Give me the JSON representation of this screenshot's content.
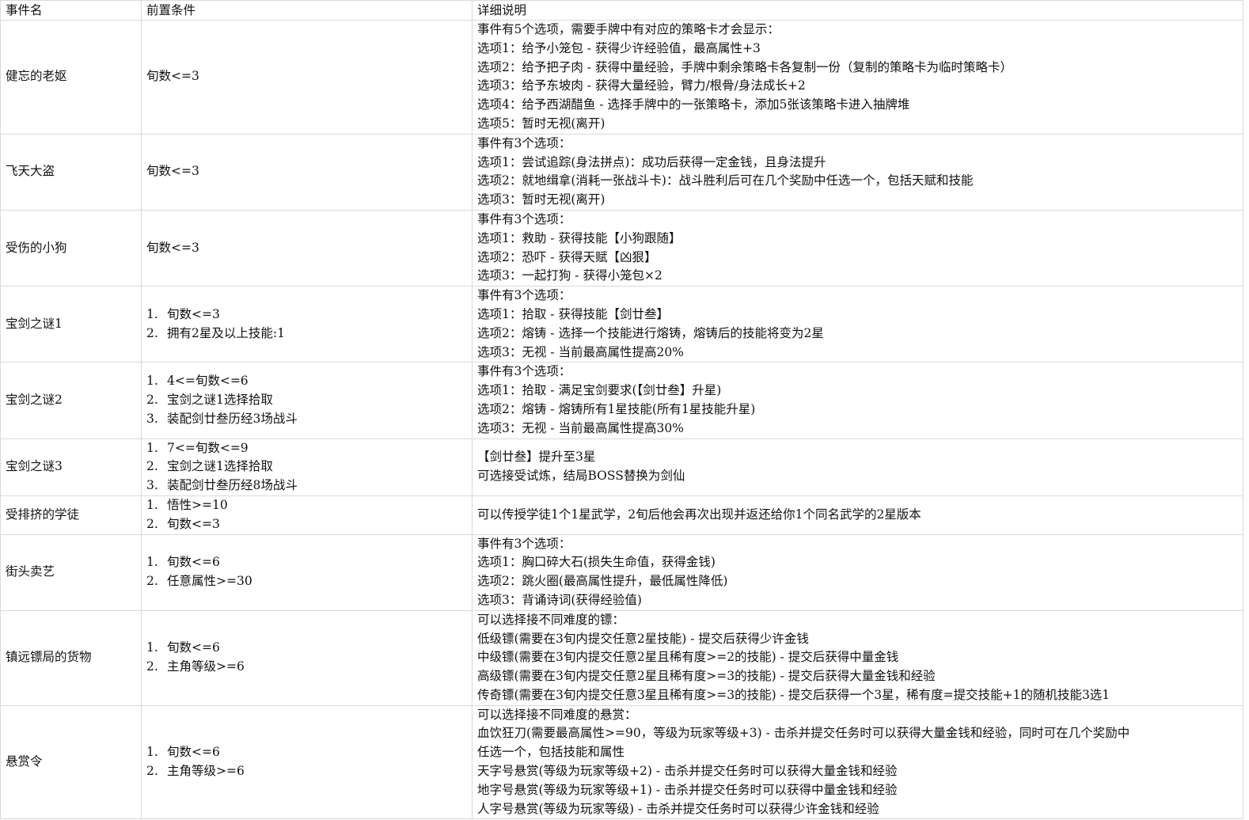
{
  "headers": {
    "event_name": "事件名",
    "precondition": "前置条件",
    "details": "详细说明"
  },
  "rows": [
    {
      "name": "健忘的老妪",
      "pre": [
        "旬数<=3"
      ],
      "details": [
        "事件有5个选项，需要手牌中有对应的策略卡才会显示：",
        "选项1：给予小笼包 - 获得少许经验值，最高属性+3",
        "选项2：给予把子肉 - 获得中量经验，手牌中剩余策略卡各复制一份（复制的策略卡为临时策略卡）",
        "选项3：给予东坡肉 - 获得大量经验，臂力/根骨/身法成长+2",
        "选项4：给予西湖醋鱼 - 选择手牌中的一张策略卡，添加5张该策略卡进入抽牌堆",
        "选项5：暂时无视(离开)"
      ]
    },
    {
      "name": "飞天大盗",
      "pre": [
        "旬数<=3"
      ],
      "details": [
        "事件有3个选项：",
        "选项1：尝试追踪(身法拼点)：成功后获得一定金钱，且身法提升",
        "选项2：就地缉拿(消耗一张战斗卡)：战斗胜利后可在几个奖励中任选一个，包括天赋和技能",
        "选项3：暂时无视(离开)"
      ]
    },
    {
      "name": "受伤的小狗",
      "pre": [
        "旬数<=3"
      ],
      "details": [
        "事件有3个选项：",
        "选项1：救助 - 获得技能【小狗跟随】",
        "选项2：恐吓 - 获得天赋【凶狠】",
        "选项3：一起打狗 - 获得小笼包×2"
      ]
    },
    {
      "name": "宝剑之谜1",
      "pre": [
        "旬数<=3",
        "拥有2星及以上技能:1"
      ],
      "numbered": true,
      "details": [
        "事件有3个选项：",
        "选项1：拾取 - 获得技能【剑廿叁】",
        "选项2：熔铸 - 选择一个技能进行熔铸，熔铸后的技能将变为2星",
        "选项3：无视 - 当前最高属性提高20%"
      ]
    },
    {
      "name": "宝剑之谜2",
      "pre": [
        "4<=旬数<=6",
        "宝剑之谜1选择拾取",
        "装配剑廿叁历经3场战斗"
      ],
      "numbered": true,
      "details": [
        "事件有3个选项：",
        "选项1：拾取 - 满足宝剑要求(【剑廿叁】升星)",
        "选项2：熔铸 - 熔铸所有1星技能(所有1星技能升星)",
        "选项3：无视 - 当前最高属性提高30%"
      ]
    },
    {
      "name": "宝剑之谜3",
      "pre": [
        "7<=旬数<=9",
        "宝剑之谜1选择拾取",
        "装配剑廿叁历经8场战斗"
      ],
      "numbered": true,
      "details": [
        "【剑廿叁】提升至3星",
        "可选接受试炼，结局BOSS替换为剑仙"
      ]
    },
    {
      "name": "受排挤的学徒",
      "pre": [
        "悟性>=10",
        "旬数<=3"
      ],
      "numbered": true,
      "details": [
        "可以传授学徒1个1星武学，2旬后他会再次出现并返还给你1个同名武学的2星版本"
      ]
    },
    {
      "name": "街头卖艺",
      "pre": [
        "旬数<=6",
        "任意属性>=30"
      ],
      "numbered": true,
      "details": [
        "事件有3个选项：",
        "选项1：胸口碎大石(损失生命值，获得金钱)",
        "选项2：跳火圈(最高属性提升，最低属性降低)",
        "选项3：背诵诗词(获得经验值)"
      ]
    },
    {
      "name": "镇远镖局的货物",
      "pre": [
        "旬数<=6",
        "主角等级>=6"
      ],
      "numbered": true,
      "details": [
        "可以选择接不同难度的镖：",
        "低级镖(需要在3旬内提交任意2星技能) - 提交后获得少许金钱",
        "中级镖(需要在3旬内提交任意2星且稀有度>=2的技能) - 提交后获得中量金钱",
        "高级镖(需要在3旬内提交任意2星且稀有度>=3的技能) - 提交后获得大量金钱和经验",
        "传奇镖(需要在3旬内提交任意3星且稀有度>=3的技能) - 提交后获得一个3星，稀有度=提交技能+1的随机技能3选1"
      ]
    },
    {
      "name": "悬赏令",
      "pre": [
        "旬数<=6",
        "主角等级>=6"
      ],
      "numbered": true,
      "details": [
        "可以选择接不同难度的悬赏：",
        "血饮狂刀(需要最高属性>=90，等级为玩家等级+3) - 击杀并提交任务时可以获得大量金钱和经验，同时可在几个奖励中",
        "任选一个，包括技能和属性",
        "天字号悬赏(等级为玩家等级+2)  - 击杀并提交任务时可以获得大量金钱和经验",
        "地字号悬赏(等级为玩家等级+1)  - 击杀并提交任务时可以获得中量金钱和经验",
        "人字号悬赏(等级为玩家等级)  - 击杀并提交任务时可以获得少许金钱和经验"
      ]
    }
  ]
}
